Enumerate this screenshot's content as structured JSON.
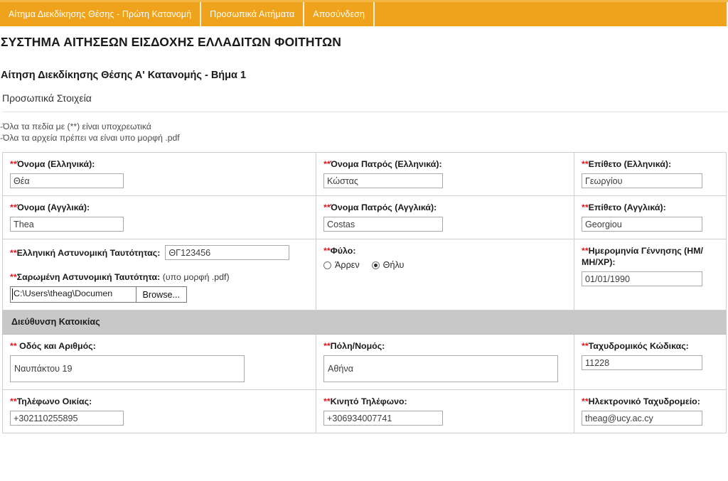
{
  "nav": {
    "items": [
      {
        "label": "Αίτημα Διεκδίκησης Θέσης - Πρώτη Κατανομή"
      },
      {
        "label": "Προσωπικά Αιτήματα"
      },
      {
        "label": "Αποσύνδεση"
      }
    ]
  },
  "header": {
    "site_title": "ΣΥΣΤΗΜΑ ΑΙΤΗΣΕΩΝ ΕΙΣΔΟΧΗΣ ΕΛΛΑΔΙΤΩΝ ΦΟΙΤΗΤΩΝ",
    "form_title": "Αίτηση Διεκδίκησης Θέσης Α' Κατανομής - Βήμα 1",
    "section_subtitle": "Προσωπικά Στοιχεία"
  },
  "notes": {
    "line1": "-Όλα τα πεδία με (**) είναι υποχρεωτικά",
    "line2": "-Όλα τα αρχεία πρέπει να είναι υπο μορφή .pdf"
  },
  "fields": {
    "first_name_gr": {
      "label": "Όνομα (Ελληνικά):",
      "value": "Θέα"
    },
    "father_name_gr": {
      "label": "Όνομα Πατρός (Ελληνικά):",
      "value": "Κώστας"
    },
    "last_name_gr": {
      "label": "Επίθετο (Ελληνικά):",
      "value": "Γεωργίου"
    },
    "first_name_en": {
      "label": "Όνομα (Αγγλικά):",
      "value": "Thea"
    },
    "father_name_en": {
      "label": "Όνομα Πατρός (Αγγλικά):",
      "value": "Costas"
    },
    "last_name_en": {
      "label": "Επίθετο (Αγγλικά):",
      "value": "Georgiou"
    },
    "id_number": {
      "label": "Ελληνική Αστυνομική Ταυτότητας:",
      "value": "ΘΓ123456"
    },
    "id_scan": {
      "label": "Σαρωμένη Αστυνομική Ταυτότητα:",
      "hint": "(υπο μορφή .pdf)",
      "value": "C:\\Users\\theag\\Documen",
      "browse_label": "Browse..."
    },
    "gender": {
      "label": "Φύλο:",
      "options": [
        {
          "label": "Άρρεν",
          "selected": false
        },
        {
          "label": "Θήλυ",
          "selected": true
        }
      ]
    },
    "birth_date": {
      "label": "Ημερομηνία Γέννησης (ΗΜ/ΜΗ/ΧΡ):",
      "value": "01/01/1990"
    }
  },
  "address_section": {
    "title": "Διεύθυνση Κατοικίας",
    "street": {
      "label": "Οδός και Αριθμός:",
      "value": "Ναυπάκτου 19"
    },
    "city": {
      "label": "Πόλη/Νομός:",
      "value": "Αθήνα"
    },
    "postcode": {
      "label": "Ταχυδρομικός Κώδικας:",
      "value": "11228"
    },
    "home_phone": {
      "label": "Τηλέφωνο Οικίας:",
      "value": "+302110255895"
    },
    "mobile_phone": {
      "label": "Κινητό Τηλέφωνο:",
      "value": "+306934007741"
    },
    "email": {
      "label": "Ηλεκτρονικό Ταχυδρομείο:",
      "value": "theag@ucy.ac.cy"
    }
  },
  "marks": {
    "required": "**"
  },
  "colors": {
    "nav_background": "#efa31d",
    "nav_border": "#f3b646",
    "required_red": "#e8141b",
    "band_gray": "#c8c8c8"
  }
}
